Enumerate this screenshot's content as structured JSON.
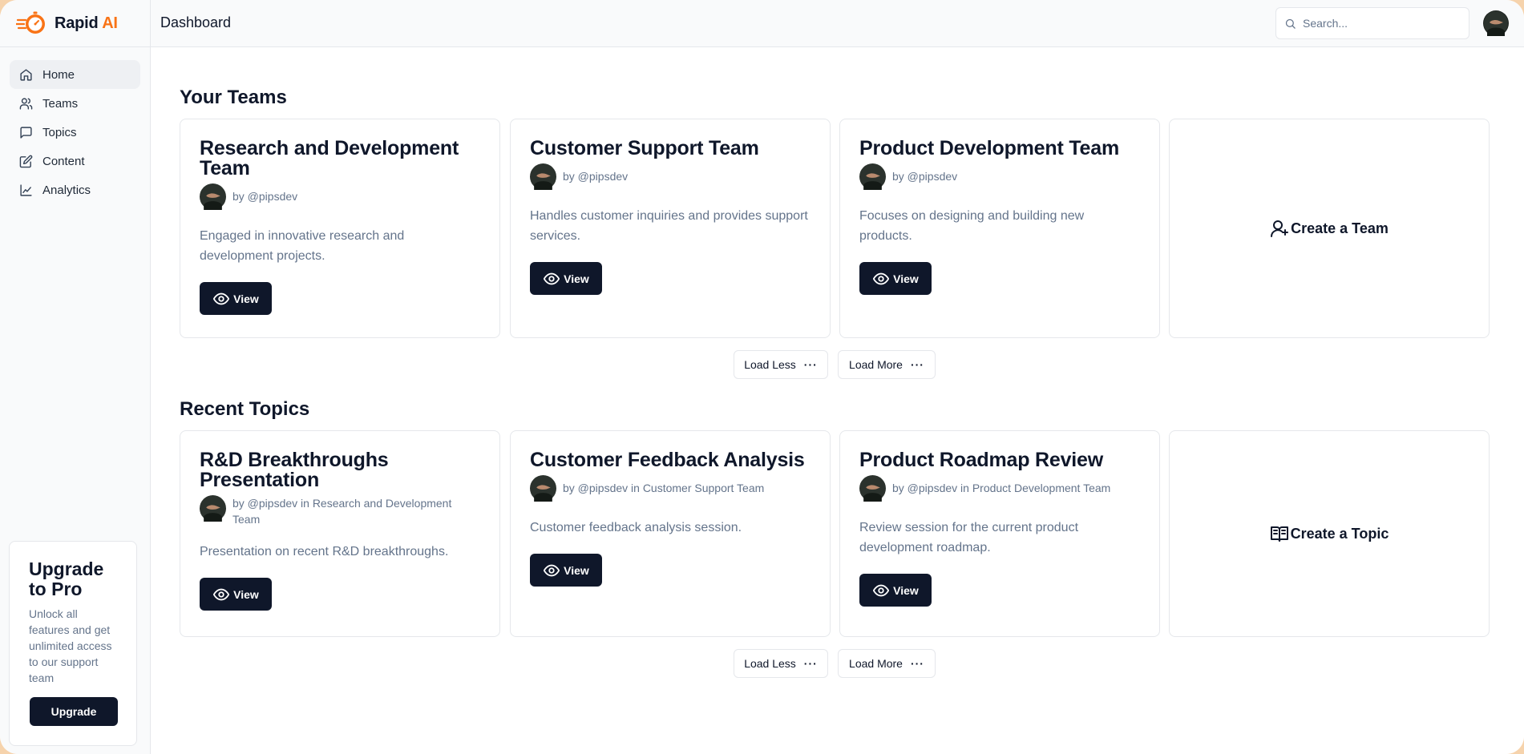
{
  "brand": {
    "name": "Rapid",
    "name_accent": "AI"
  },
  "header": {
    "title": "Dashboard",
    "search_placeholder": "Search..."
  },
  "nav": [
    {
      "label": "Home",
      "icon": "home-icon",
      "active": true
    },
    {
      "label": "Teams",
      "icon": "users-icon"
    },
    {
      "label": "Topics",
      "icon": "message-square-icon"
    },
    {
      "label": "Content",
      "icon": "edit-icon"
    },
    {
      "label": "Analytics",
      "icon": "line-chart-icon"
    }
  ],
  "upgrade": {
    "title": "Upgrade to Pro",
    "text": "Unlock all features and get unlimited access to our support team",
    "button": "Upgrade"
  },
  "teams_section": {
    "title": "Your Teams",
    "cards": [
      {
        "title": "Research and Development Team",
        "byline": "by @pipsdev",
        "description": "Engaged in innovative research and development projects.",
        "button": "View"
      },
      {
        "title": "Customer Support Team",
        "byline": "by @pipsdev",
        "description": "Handles customer inquiries and provides support services.",
        "button": "View"
      },
      {
        "title": "Product Development Team",
        "byline": "by @pipsdev",
        "description": "Focuses on designing and building new products.",
        "button": "View"
      }
    ],
    "create_label": "Create a Team",
    "load_less": "Load Less",
    "load_more": "Load More"
  },
  "topics_section": {
    "title": "Recent Topics",
    "cards": [
      {
        "title": "R&D Breakthroughs Presentation",
        "byline": "by @pipsdev in Research and Development Team",
        "description": "Presentation on recent R&D breakthroughs.",
        "button": "View"
      },
      {
        "title": "Customer Feedback Analysis",
        "byline": "by @pipsdev in Customer Support Team",
        "description": "Customer feedback analysis session.",
        "button": "View"
      },
      {
        "title": "Product Roadmap Review",
        "byline": "by @pipsdev in Product Development Team",
        "description": "Review session for the current product development roadmap.",
        "button": "View"
      }
    ],
    "create_label": "Create a Topic",
    "load_less": "Load Less",
    "load_more": "Load More"
  },
  "colors": {
    "accent": "#f97316",
    "primary_button": "#0f172a",
    "frame_background": "#f6d3ac"
  }
}
